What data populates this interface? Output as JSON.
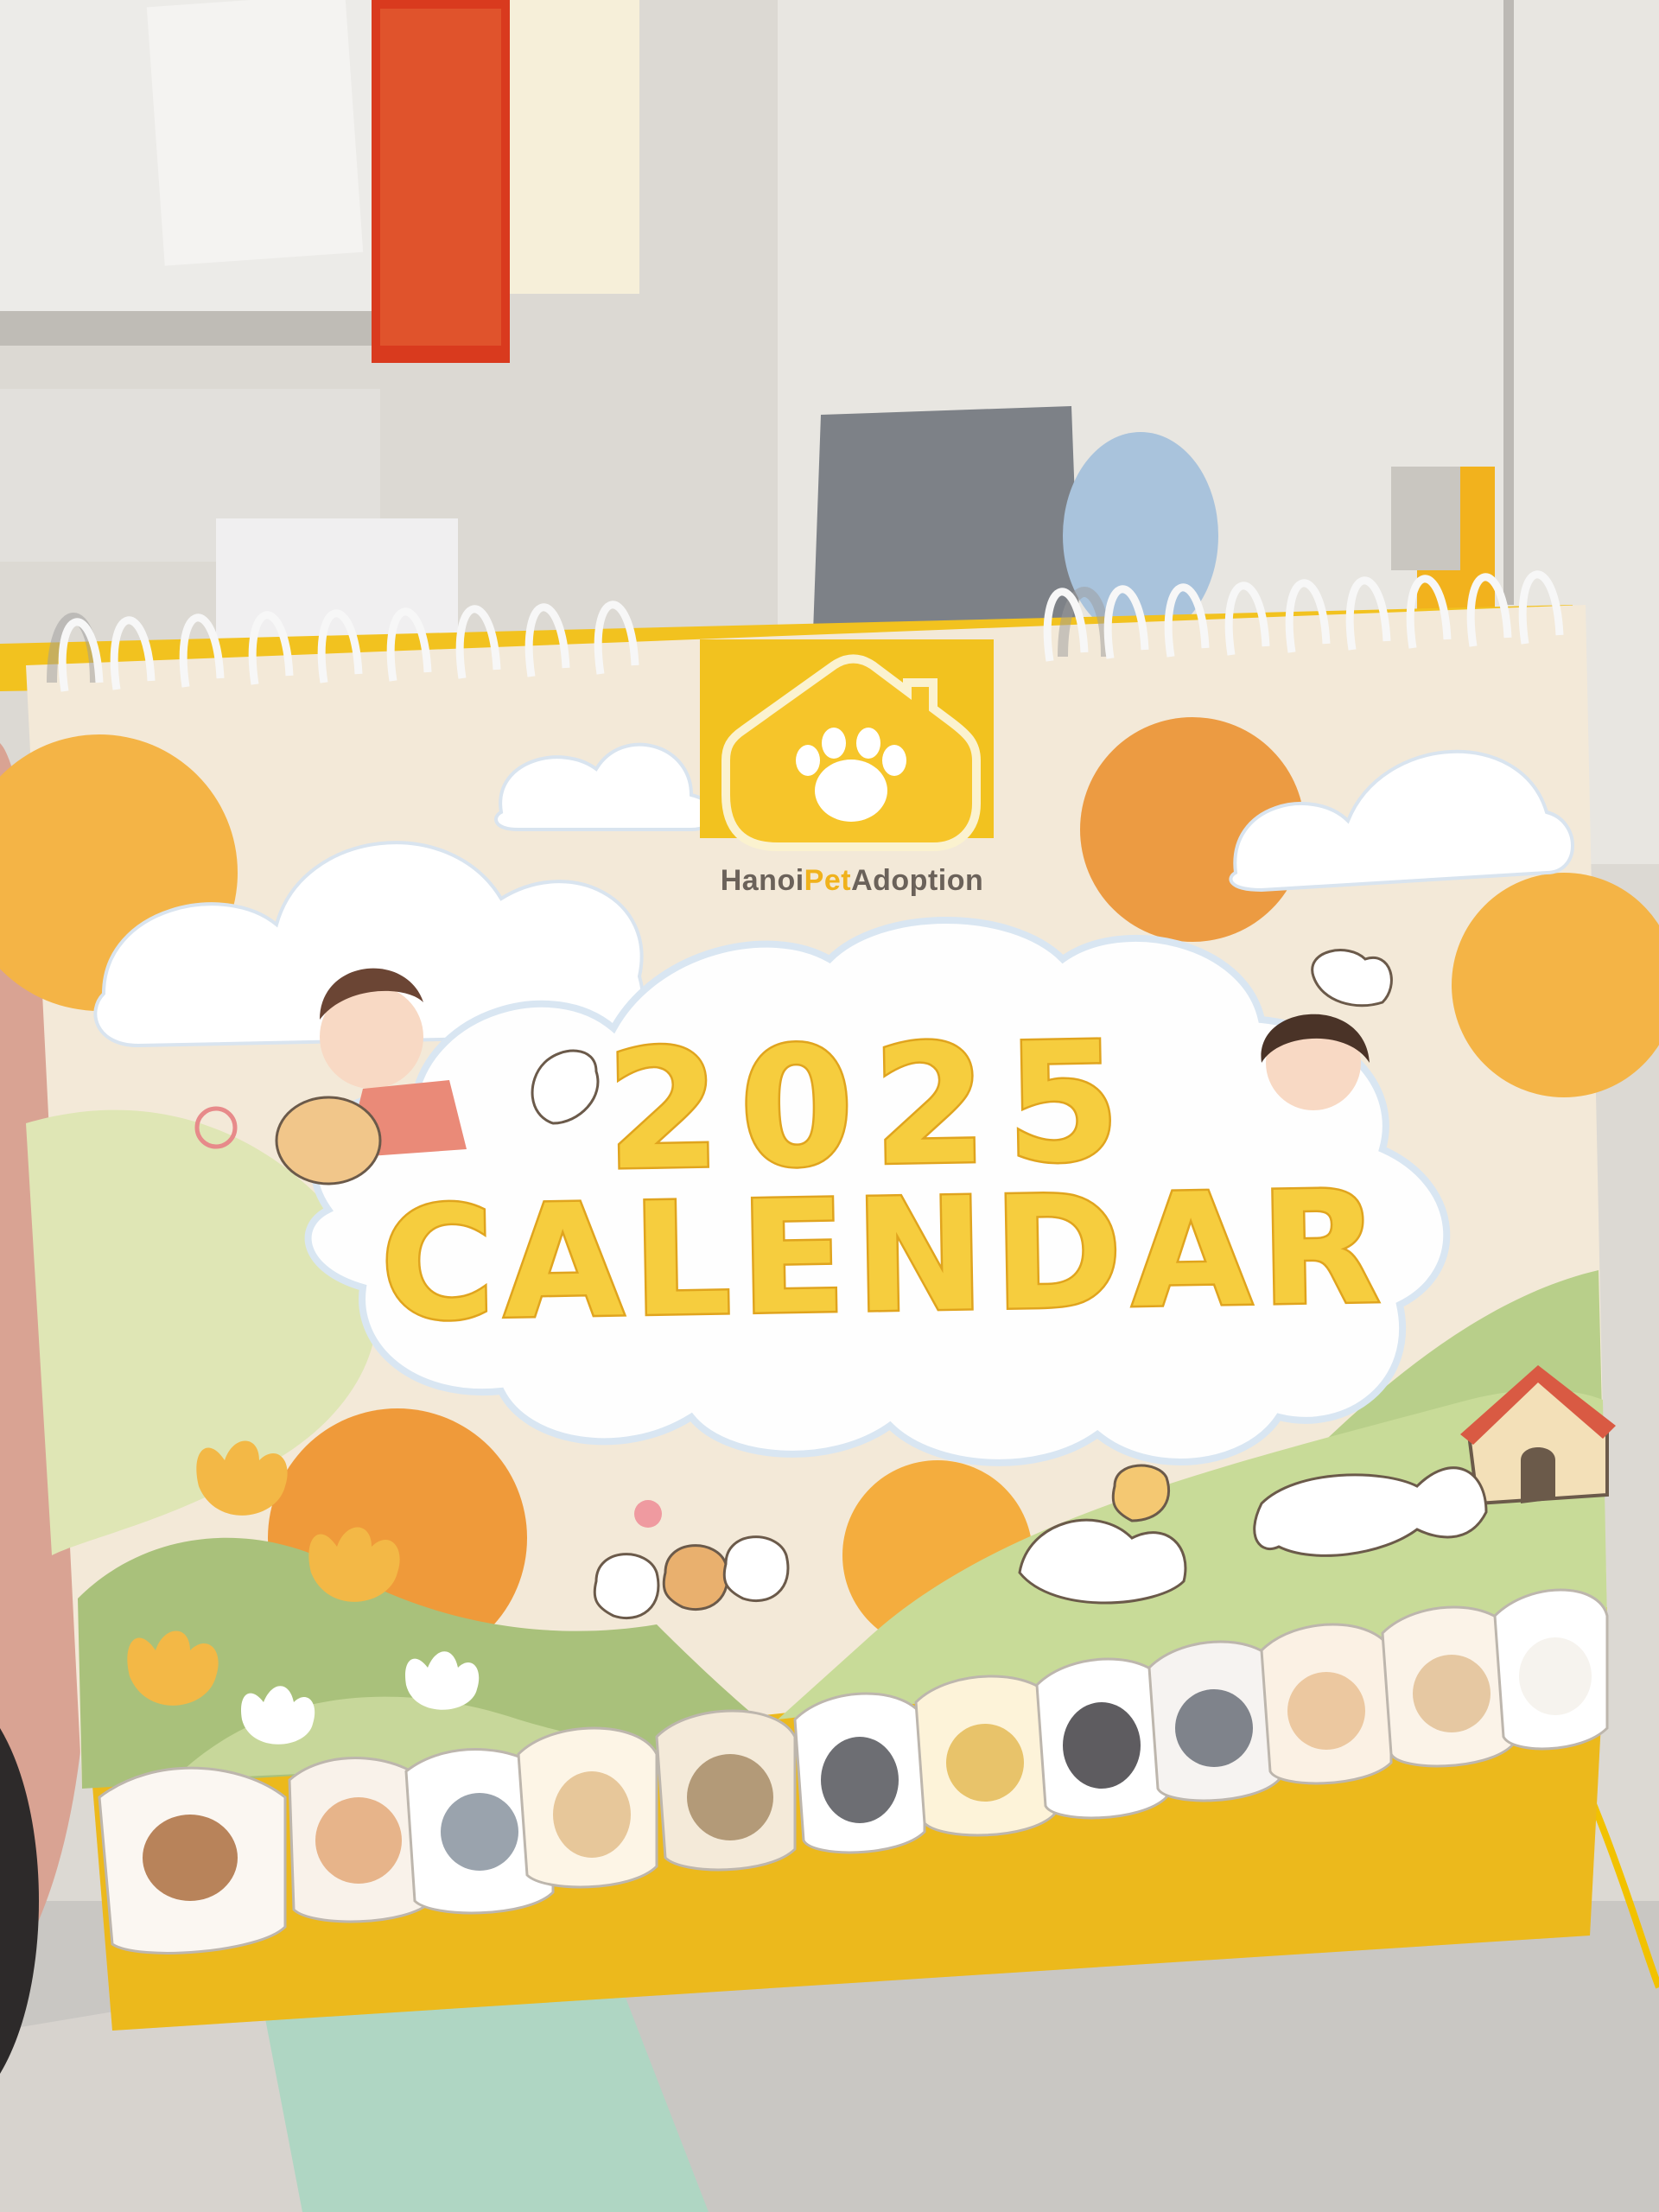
{
  "calendar": {
    "brand": {
      "name_parts": [
        "Hanoi",
        "Pet",
        "Adoption"
      ],
      "accent_color": "#f0b21c",
      "text_color": "#6b625a",
      "icon": "house-paw-icon"
    },
    "cover": {
      "year": "2025",
      "word": "CALENDAR",
      "title_color": "#f6cd3e"
    }
  }
}
